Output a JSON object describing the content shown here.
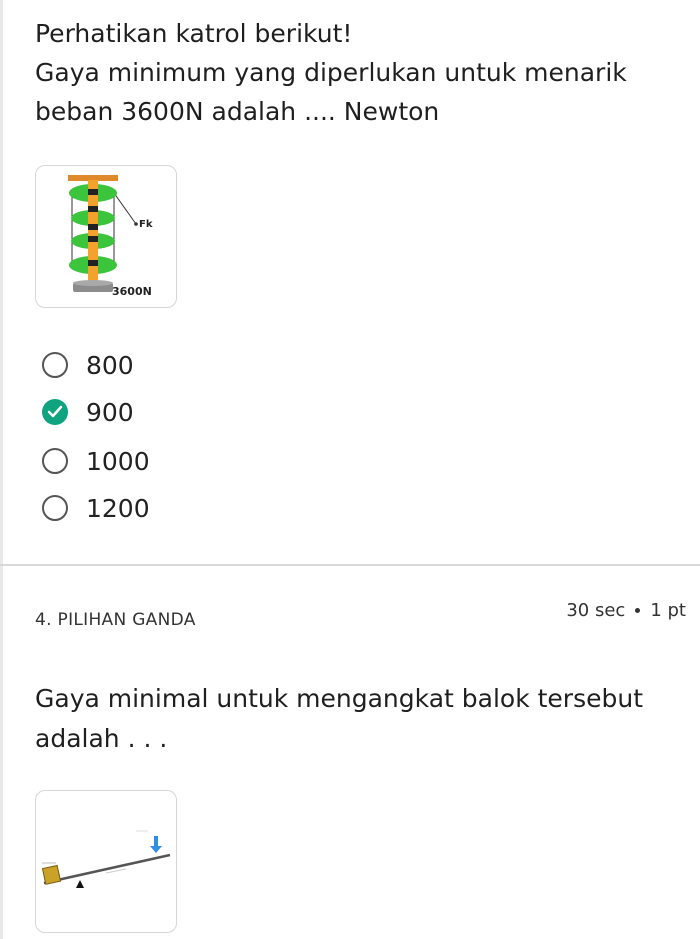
{
  "question3": {
    "lines": [
      "Perhatikan katrol berikut!",
      "Gaya minimum yang diperlukan untuk menarik",
      "beban 3600N adalah .... Newton"
    ],
    "image": {
      "force_label": "Fk",
      "load_label": "3600N"
    },
    "options": [
      {
        "label": "800",
        "selected": false
      },
      {
        "label": "900",
        "selected": true
      },
      {
        "label": "1000",
        "selected": false
      },
      {
        "label": "1200",
        "selected": false
      }
    ],
    "accent_color": "#10a37f"
  },
  "question4": {
    "type_label": "4. PILIHAN GANDA",
    "time": "30 sec",
    "points": "1 pt",
    "lines": [
      "Gaya minimal untuk mengangkat balok tersebut",
      "adalah . . ."
    ]
  }
}
